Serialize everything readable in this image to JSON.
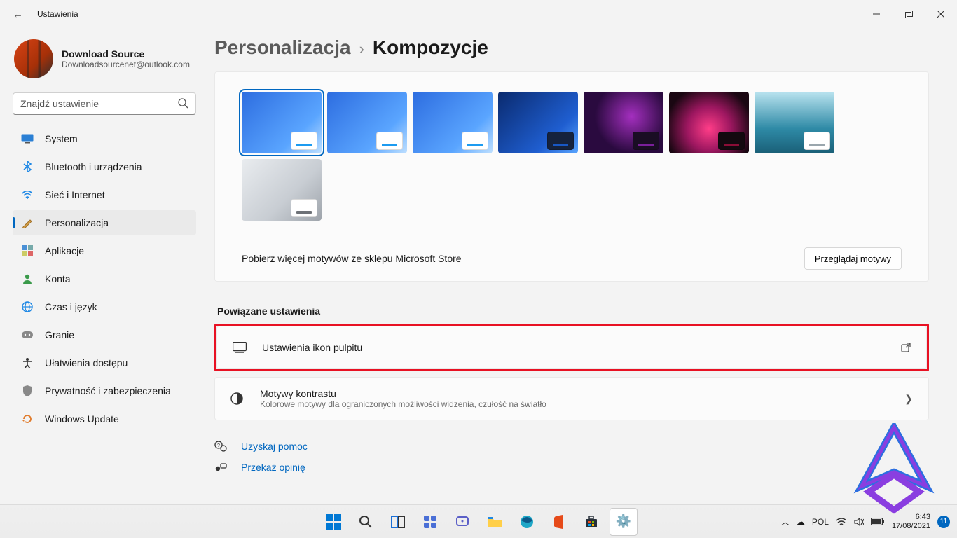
{
  "window": {
    "title": "Ustawienia"
  },
  "account": {
    "name": "Download Source",
    "email": "Downloadsourcenet@outlook.com"
  },
  "search": {
    "placeholder": "Znajdź ustawienie"
  },
  "nav": [
    {
      "label": "System",
      "icon": "🖥️"
    },
    {
      "label": "Bluetooth i urządzenia",
      "icon": "b"
    },
    {
      "label": "Sieć i Internet",
      "icon": "w"
    },
    {
      "label": "Personalizacja",
      "icon": "🖌️",
      "active": true
    },
    {
      "label": "Aplikacje",
      "icon": "a"
    },
    {
      "label": "Konta",
      "icon": "👤"
    },
    {
      "label": "Czas i język",
      "icon": "🌐"
    },
    {
      "label": "Granie",
      "icon": "🎮"
    },
    {
      "label": "Ułatwienia dostępu",
      "icon": "u"
    },
    {
      "label": "Prywatność i zabezpieczenia",
      "icon": "🛡️"
    },
    {
      "label": "Windows Update",
      "icon": "🔄"
    }
  ],
  "breadcrumb": {
    "parent": "Personalizacja",
    "current": "Kompozycje"
  },
  "themes": [
    {
      "bg": "linear-gradient(135deg,#2d6de0,#5aa5ff 70%,#bfe0ff)",
      "chip": "#ffffff",
      "bar": "#1d9bf0",
      "selected": true
    },
    {
      "bg": "linear-gradient(135deg,#2d6de0,#5aa5ff 70%,#bfe0ff)",
      "chip": "#ffffff",
      "bar": "#1d9bf0"
    },
    {
      "bg": "linear-gradient(135deg,#2d6de0,#5aa5ff 70%,#bfe0ff)",
      "chip": "#ffffff",
      "bar": "#1d9bf0"
    },
    {
      "bg": "linear-gradient(135deg,#0a2a6e,#1f5ed0 70%,#5aa5ff)",
      "chip": "#15223d",
      "bar": "#1857c4"
    },
    {
      "bg": "radial-gradient(circle at 60% 40%,#a42fbf,#2a0a3f 60%)",
      "chip": "#1a0d24",
      "bar": "#7a1f9a"
    },
    {
      "bg": "radial-gradient(circle at 50% 60%,#ff3d88,#9d1760 40%,#1a0712 80%)",
      "chip": "#13090f",
      "bar": "#8a0d36"
    },
    {
      "bg": "linear-gradient(#b9e3ef,#2e8aa6 60%,#1a5f77)",
      "chip": "#ffffff",
      "bar": "#9aa6ad"
    },
    {
      "bg": "linear-gradient(135deg,#e9ecef,#c8cdd3 60%,#9ea4ab)",
      "chip": "#ffffff",
      "bar": "#6e7277"
    }
  ],
  "store": {
    "text": "Pobierz więcej motywów ze sklepu Microsoft Store",
    "button": "Przeglądaj motywy"
  },
  "related": {
    "title": "Powiązane ustawienia",
    "desktop_icons": {
      "label": "Ustawienia ikon pulpitu"
    },
    "contrast": {
      "title": "Motywy kontrastu",
      "sub": "Kolorowe motywy dla ograniczonych możliwości widzenia, czułość na światło"
    }
  },
  "footer_links": {
    "help": "Uzyskaj pomoc",
    "feedback": "Przekaż opinię"
  },
  "taskbar": {
    "lang": "POL",
    "time": "6:43",
    "date": "17/08/2021",
    "notif_count": "11"
  }
}
